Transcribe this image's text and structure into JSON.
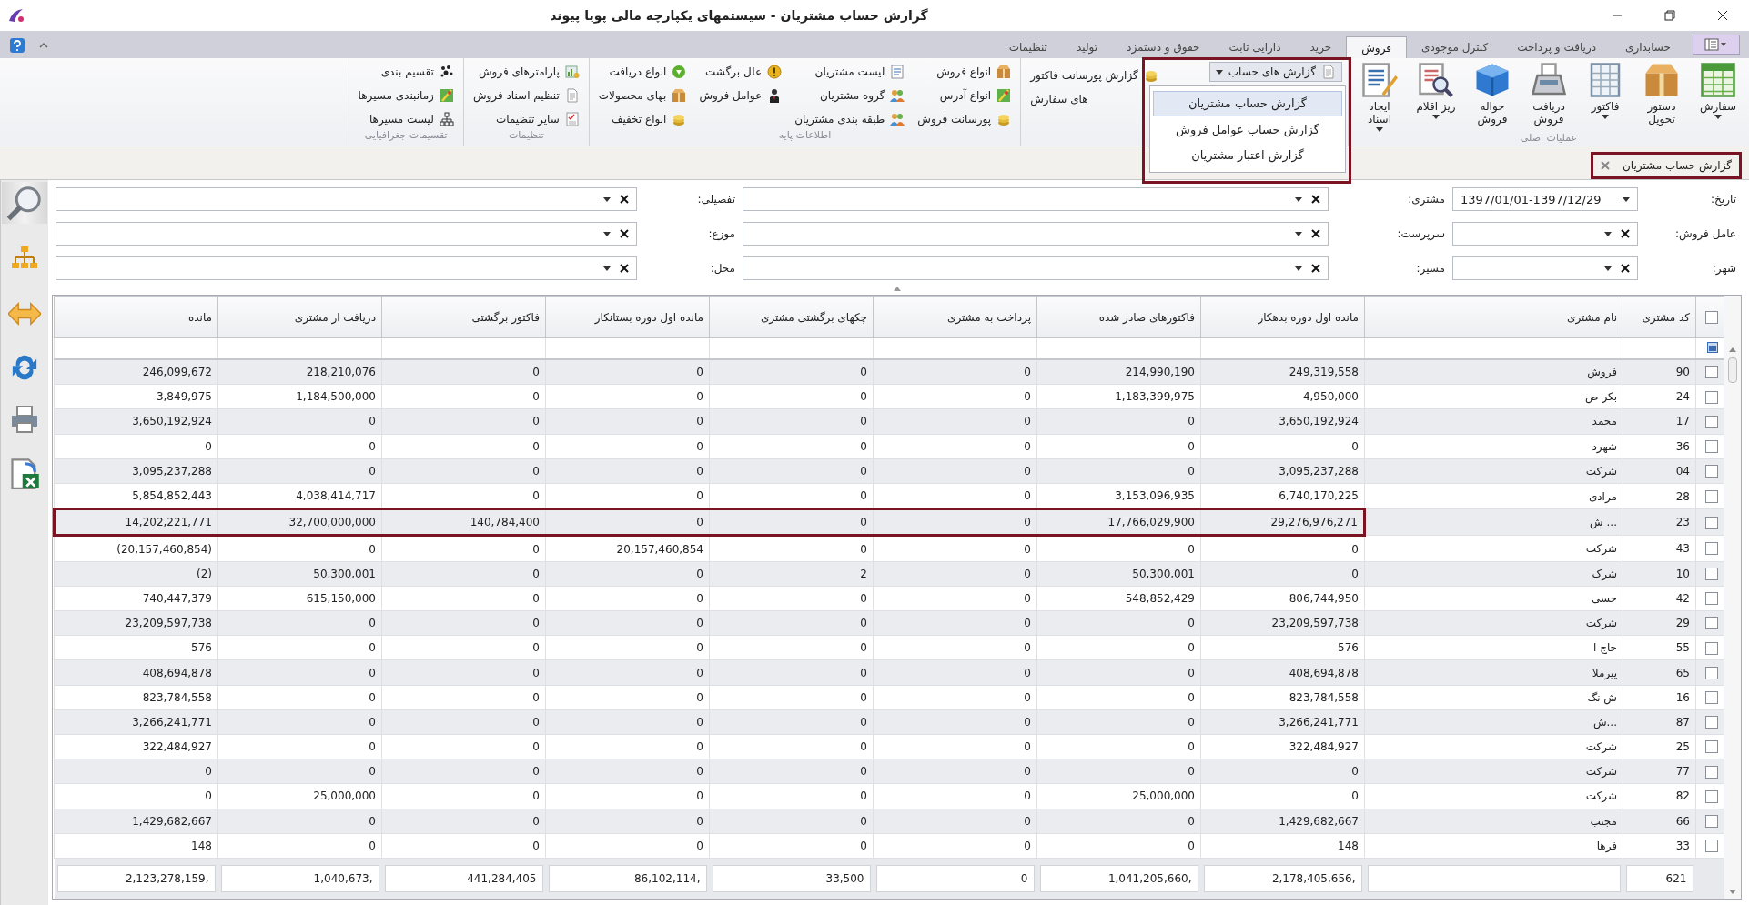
{
  "window": {
    "title": "گزارش حساب مشتریان - سیستمهای یکپارچه مالی پویا پیوند"
  },
  "ribbon_tabs": [
    {
      "label": "حسابداری",
      "selected": false
    },
    {
      "label": "دریافت و پرداخت",
      "selected": false
    },
    {
      "label": "کنترل موجودی",
      "selected": false
    },
    {
      "label": "فروش",
      "selected": true
    },
    {
      "label": "خرید",
      "selected": false
    },
    {
      "label": "دارایی ثابت",
      "selected": false
    },
    {
      "label": "حقوق و دستمزد",
      "selected": false
    },
    {
      "label": "تولید",
      "selected": false
    },
    {
      "label": "تنظیمات",
      "selected": false
    }
  ],
  "main_group": {
    "label": "عملیات اصلی",
    "buttons": [
      {
        "label": "سفارش",
        "dropdown": true
      },
      {
        "label": "دستور تحویل",
        "dropdown": false
      },
      {
        "label": "فاکتور",
        "dropdown": true
      },
      {
        "label": "دریافت فروش",
        "dropdown": false
      },
      {
        "label": "حواله فروش",
        "dropdown": false
      },
      {
        "label": "ریز اقلام",
        "dropdown": true
      },
      {
        "label": "ایجاد اسناد",
        "dropdown": true
      }
    ]
  },
  "reports_group": {
    "dropdown": {
      "label": "گزارش های حساب",
      "expanded": true,
      "highlighted": true,
      "items": [
        {
          "label": "گزارش حساب مشتریان",
          "selected": true
        },
        {
          "label": "گزارش حساب عوامل فروش",
          "selected": false
        },
        {
          "label": "گزارش اعتبار مشتریان",
          "selected": false
        }
      ]
    },
    "items": [
      "گزارش پورسانت فاکتور",
      "های سفارش"
    ]
  },
  "small_groups": [
    {
      "label": "اطلاعات پایه",
      "columns": [
        [
          "انواع فروش",
          "انواع آدرس",
          "پورسانت فروش"
        ],
        [
          "لیست مشتریان",
          "گروه مشتریان",
          "طبقه بندی مشتریان"
        ],
        [
          "علل برگشت",
          "عوامل فروش"
        ],
        [
          "انواع دریافت",
          "بهای محصولات",
          "انواع تخفیف"
        ]
      ]
    },
    {
      "label": "تنظیمات",
      "columns": [
        [
          "پارامترهای فروش",
          "تنظیم اسناد فروش",
          "سایر تنظیمات"
        ]
      ]
    },
    {
      "label": "تقسیمات جغرافیایی",
      "columns": [
        [
          "تقسیم بندی",
          "زمانبندی مسیرها",
          "لیست مسیرها"
        ]
      ]
    }
  ],
  "document_tab": {
    "label": "گزارش حساب مشتریان",
    "highlighted": true
  },
  "filters": [
    {
      "label": "تاریخ:",
      "value": "1397/01/01-1397/12/29",
      "clearable": false
    },
    {
      "label": "مشتری:",
      "clearable": true
    },
    {
      "label": "تفصیلی:",
      "clearable": true
    },
    {
      "label": "عامل فروش:",
      "clearable": true
    },
    {
      "label": "سرپرست:",
      "clearable": true
    },
    {
      "label": "موزع:",
      "clearable": true
    },
    {
      "label": "شهر:",
      "clearable": true
    },
    {
      "label": "مسیر:",
      "clearable": true
    },
    {
      "label": "محل:",
      "clearable": true
    }
  ],
  "grid": {
    "columns": [
      "کد مشتری",
      "نام مشتری",
      "مانده اول دوره بدهکار",
      "فاکتورهای صادر شده",
      "پرداخت به مشتری",
      "چکهای برگشتی مشتری",
      "مانده اول دوره بستانکار",
      "فاکتور برگشتی",
      "دریافت از مشتری",
      "مانده"
    ],
    "rows": [
      {
        "checked": false,
        "highlighted": false,
        "code": "90",
        "name": "فروش",
        "values": [
          "249,319,558",
          "214,990,190",
          "0",
          "0",
          "0",
          "0",
          "218,210,076",
          "246,099,672"
        ]
      },
      {
        "checked": false,
        "highlighted": false,
        "code": "24",
        "name": "بکر ص",
        "values": [
          "4,950,000",
          "1,183,399,975",
          "0",
          "0",
          "0",
          "0",
          "1,184,500,000",
          "3,849,975"
        ]
      },
      {
        "checked": false,
        "highlighted": false,
        "code": "17",
        "name": "محمد",
        "values": [
          "3,650,192,924",
          "0",
          "0",
          "0",
          "0",
          "0",
          "0",
          "3,650,192,924"
        ]
      },
      {
        "checked": false,
        "highlighted": false,
        "code": "36",
        "name": "شهرد",
        "values": [
          "0",
          "0",
          "0",
          "0",
          "0",
          "0",
          "0",
          "0"
        ]
      },
      {
        "checked": false,
        "highlighted": false,
        "code": "04",
        "name": "شرکت",
        "values": [
          "3,095,237,288",
          "0",
          "0",
          "0",
          "0",
          "0",
          "0",
          "3,095,237,288"
        ]
      },
      {
        "checked": false,
        "highlighted": false,
        "code": "28",
        "name": "مرادی",
        "values": [
          "6,740,170,225",
          "3,153,096,935",
          "0",
          "0",
          "0",
          "0",
          "4,038,414,717",
          "5,854,852,443"
        ]
      },
      {
        "checked": false,
        "highlighted": true,
        "code": "23",
        "name": "... ش",
        "values": [
          "29,276,976,271",
          "17,766,029,900",
          "0",
          "0",
          "0",
          "140,784,400",
          "32,700,000,000",
          "14,202,221,771"
        ]
      },
      {
        "checked": false,
        "highlighted": false,
        "code": "43",
        "name": "شرکت",
        "values": [
          "0",
          "0",
          "0",
          "0",
          "20,157,460,854",
          "0",
          "0",
          "(20,157,460,854)"
        ]
      },
      {
        "checked": false,
        "highlighted": false,
        "code": "10",
        "name": "شرک",
        "values": [
          "0",
          "50,300,001",
          "0",
          "2",
          "0",
          "0",
          "50,300,001",
          "(2)"
        ]
      },
      {
        "checked": false,
        "highlighted": false,
        "code": "42",
        "name": "حسی",
        "values": [
          "806,744,950",
          "548,852,429",
          "0",
          "0",
          "0",
          "0",
          "615,150,000",
          "740,447,379"
        ]
      },
      {
        "checked": false,
        "highlighted": false,
        "code": "29",
        "name": "شرکت",
        "values": [
          "23,209,597,738",
          "0",
          "0",
          "0",
          "0",
          "0",
          "0",
          "23,209,597,738"
        ]
      },
      {
        "checked": false,
        "highlighted": false,
        "code": "55",
        "name": "حاج ا",
        "values": [
          "576",
          "0",
          "0",
          "0",
          "0",
          "0",
          "0",
          "576"
        ]
      },
      {
        "checked": false,
        "highlighted": false,
        "code": "65",
        "name": "پیرملا",
        "values": [
          "408,694,878",
          "0",
          "0",
          "0",
          "0",
          "0",
          "0",
          "408,694,878"
        ]
      },
      {
        "checked": false,
        "highlighted": false,
        "code": "16",
        "name": "ش نگ",
        "values": [
          "823,784,558",
          "0",
          "0",
          "0",
          "0",
          "0",
          "0",
          "823,784,558"
        ]
      },
      {
        "checked": false,
        "highlighted": false,
        "code": "87",
        "name": "...ش",
        "values": [
          "3,266,241,771",
          "0",
          "0",
          "0",
          "0",
          "0",
          "0",
          "3,266,241,771"
        ]
      },
      {
        "checked": false,
        "highlighted": false,
        "code": "25",
        "name": "شرکت",
        "values": [
          "322,484,927",
          "0",
          "0",
          "0",
          "0",
          "0",
          "0",
          "322,484,927"
        ]
      },
      {
        "checked": false,
        "highlighted": false,
        "code": "77",
        "name": "شرکت",
        "values": [
          "0",
          "0",
          "0",
          "0",
          "0",
          "0",
          "0",
          "0"
        ]
      },
      {
        "checked": false,
        "highlighted": false,
        "code": "82",
        "name": "شرکت",
        "values": [
          "0",
          "25,000,000",
          "0",
          "0",
          "0",
          "0",
          "25,000,000",
          "0"
        ]
      },
      {
        "checked": false,
        "highlighted": false,
        "code": "66",
        "name": "مجتب",
        "values": [
          "1,429,682,667",
          "0",
          "0",
          "0",
          "0",
          "0",
          "0",
          "1,429,682,667"
        ]
      },
      {
        "checked": false,
        "highlighted": false,
        "code": "33",
        "name": "فرها",
        "values": [
          "148",
          "0",
          "0",
          "0",
          "0",
          "0",
          "0",
          "148"
        ]
      }
    ],
    "footer": {
      "count": "621",
      "totals": [
        "2,178,405,656,",
        "1,041,205,660,",
        "0",
        "33,500",
        "86,102,114,",
        "441,284,405",
        "1,040,673,",
        "2,123,278,159,"
      ]
    }
  }
}
